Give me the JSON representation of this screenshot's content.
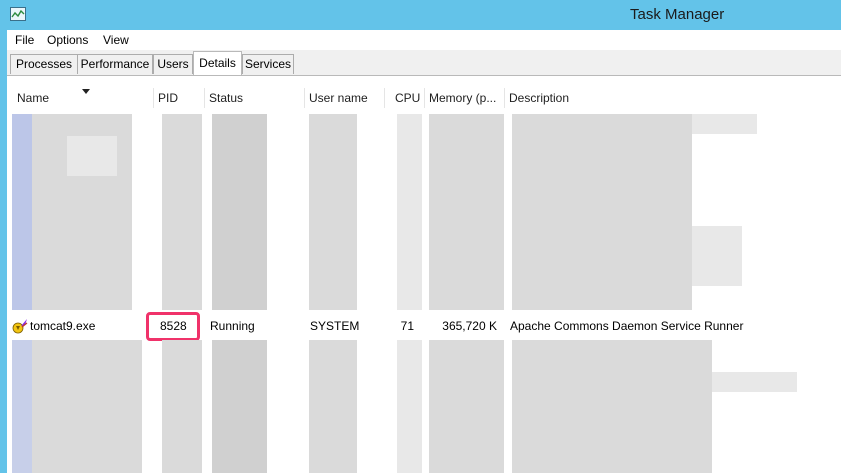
{
  "window": {
    "title": "Task Manager"
  },
  "menu": [
    "File",
    "Options",
    "View"
  ],
  "tabs": [
    "Processes",
    "Performance",
    "Users",
    "Details",
    "Services"
  ],
  "active_tab": "Details",
  "columns": [
    "Name",
    "PID",
    "Status",
    "User name",
    "CPU",
    "Memory (p...",
    "Description"
  ],
  "highlighted_row": {
    "name": "tomcat9.exe",
    "pid": "8528",
    "status": "Running",
    "user": "SYSTEM",
    "cpu": "71",
    "memory": "365,720 K",
    "description": "Apache Commons Daemon Service Runner"
  },
  "colors": {
    "titlebar": "#63c3e9",
    "highlight": "#f0326a"
  },
  "icons": {
    "app": "task-manager-icon",
    "process": "tomcat-feather-icon",
    "sort": "sort-descending-icon"
  }
}
